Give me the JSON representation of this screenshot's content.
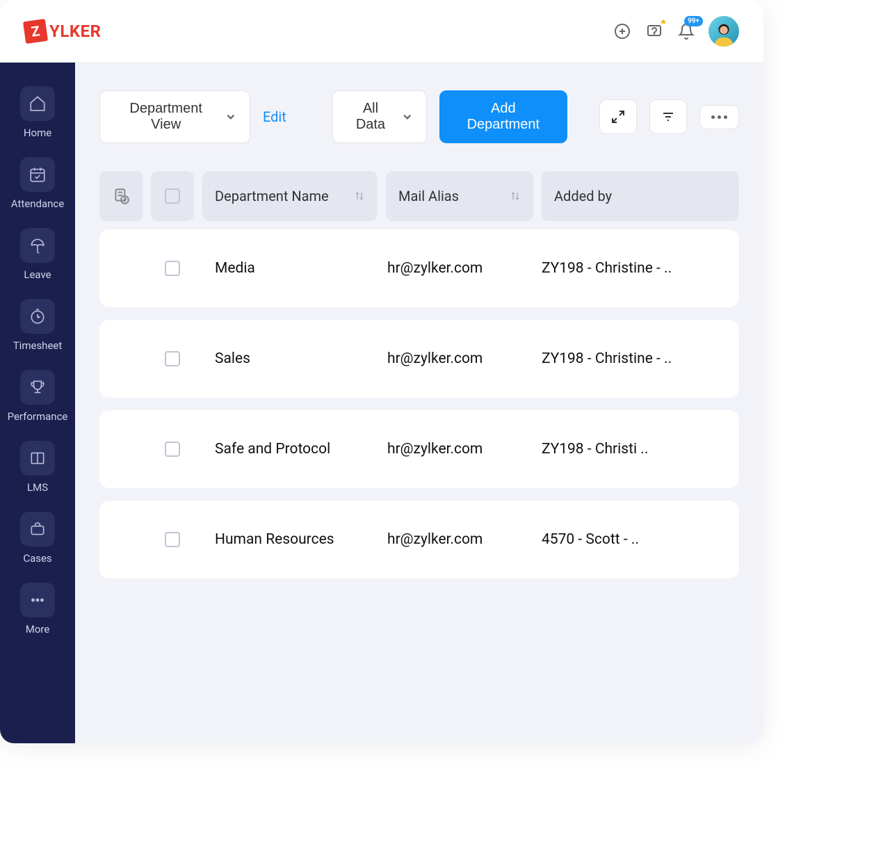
{
  "header": {
    "logo_letter": "Z",
    "logo_text": "YLKER",
    "notification_badge": "99+"
  },
  "sidebar": {
    "items": [
      {
        "label": "Home"
      },
      {
        "label": "Attendance"
      },
      {
        "label": "Leave"
      },
      {
        "label": "Timesheet"
      },
      {
        "label": "Performance"
      },
      {
        "label": "LMS"
      },
      {
        "label": "Cases"
      },
      {
        "label": "More"
      }
    ]
  },
  "toolbar": {
    "view_selector": "Department View",
    "edit_link": "Edit",
    "data_filter": "All Data",
    "add_button": "Add Department"
  },
  "table": {
    "columns": {
      "name": "Department Name",
      "mail": "Mail Alias",
      "added": "Added by"
    },
    "rows": [
      {
        "name": "Media",
        "mail": "hr@zylker.com",
        "added": "ZY198 - Christine - .."
      },
      {
        "name": "Sales",
        "mail": "hr@zylker.com",
        "added": "ZY198 - Christine - .."
      },
      {
        "name": "Safe and Protocol",
        "mail": "hr@zylker.com",
        "added": "ZY198 - Christi .."
      },
      {
        "name": "Human Resources",
        "mail": "hr@zylker.com",
        "added": "4570 - Scott - .."
      }
    ]
  }
}
